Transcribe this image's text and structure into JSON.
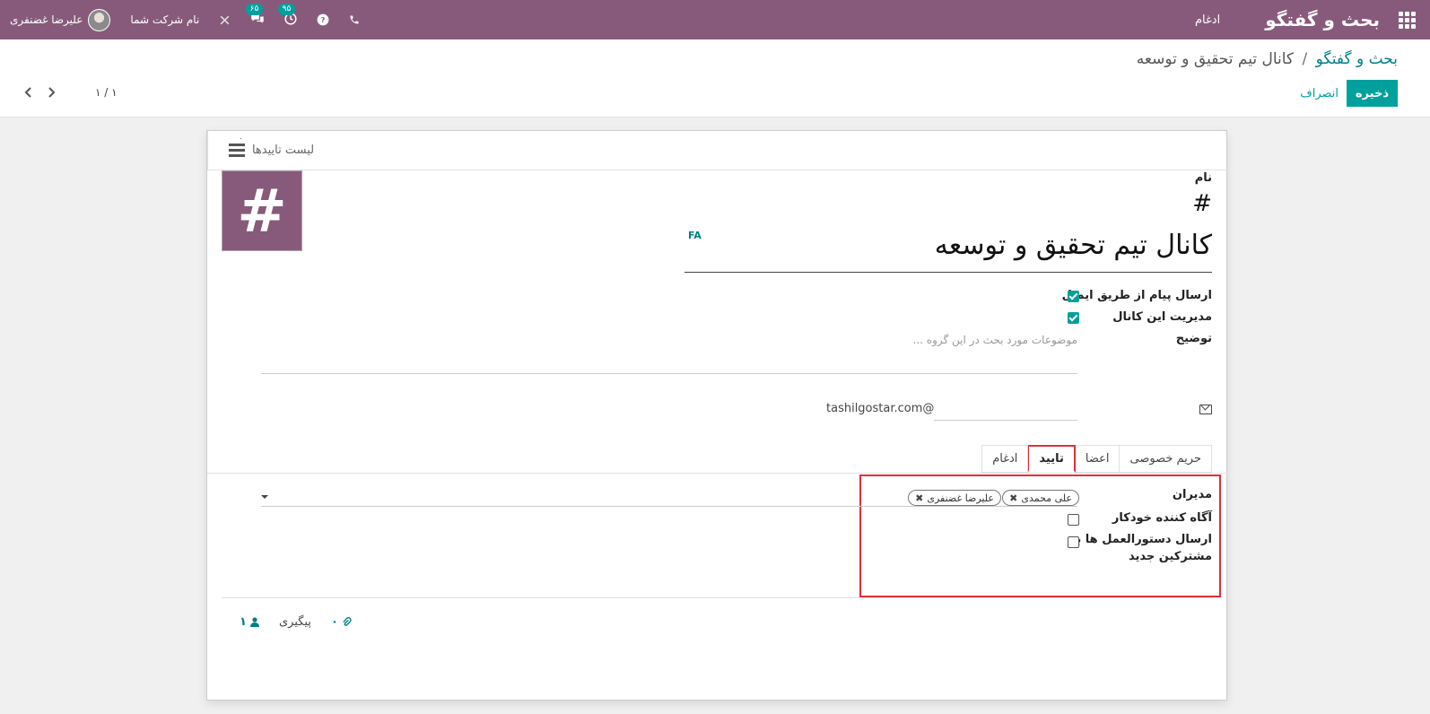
{
  "navbar": {
    "app_name": "بحث و گفتگو",
    "menu_item": "ادغام",
    "company": "نام شرکت شما",
    "user": "علیرضا غضنفری",
    "activity_count": "۹۵",
    "messages_count": "۶۵",
    "icons": [
      "apps-grid-icon",
      "phone-icon",
      "help-icon",
      "clock-icon",
      "chat-icon",
      "tools-icon"
    ]
  },
  "breadcrumb": {
    "root": "بحث و گفتگو",
    "separator": "/",
    "current": "کانال تیم تحقیق و توسعه"
  },
  "actions": {
    "save": "ذخیره",
    "discard": "انصراف"
  },
  "pager": {
    "value": "۱ / ۱"
  },
  "button_box": {
    "moderation_list": "لیست تاییدها",
    "count": "۰"
  },
  "form": {
    "name_label": "نام",
    "hash": "#",
    "name_value": "کانال تیم تحقیق و توسعه",
    "lang_tag": "FA",
    "email_send_label": "ارسال پیام از طریق ایمیل",
    "email_send_checked": true,
    "moderation_label": "مدیریت این کانال",
    "moderation_checked": true,
    "description_label": "توضیح",
    "description_placeholder": "موضوعات مورد بحث در این گروه ...",
    "alias_domain": "tashilgostar.com@"
  },
  "tabs": [
    "حریم خصوصی",
    "اعضا",
    "تایید",
    "ادغام"
  ],
  "active_tab": "تایید",
  "moderation_tab": {
    "moderators_label": "مدیران",
    "moderators": [
      "علی محمدی",
      "علیرضا غضنفری"
    ],
    "auto_notify_label": "آگاه کننده خودکار",
    "auto_notify_checked": false,
    "send_guidelines_label_line1": "ارسال دستورالعمل ها به",
    "send_guidelines_label_line2": "مشترکین جدید",
    "send_guidelines_checked": false
  },
  "chatter": {
    "follow_label": "پیگیری",
    "attachments_count": "۰",
    "followers_count": "۱"
  },
  "colors": {
    "brand": "#875a7b",
    "accent": "#00a09d",
    "highlight": "#e0303a"
  }
}
